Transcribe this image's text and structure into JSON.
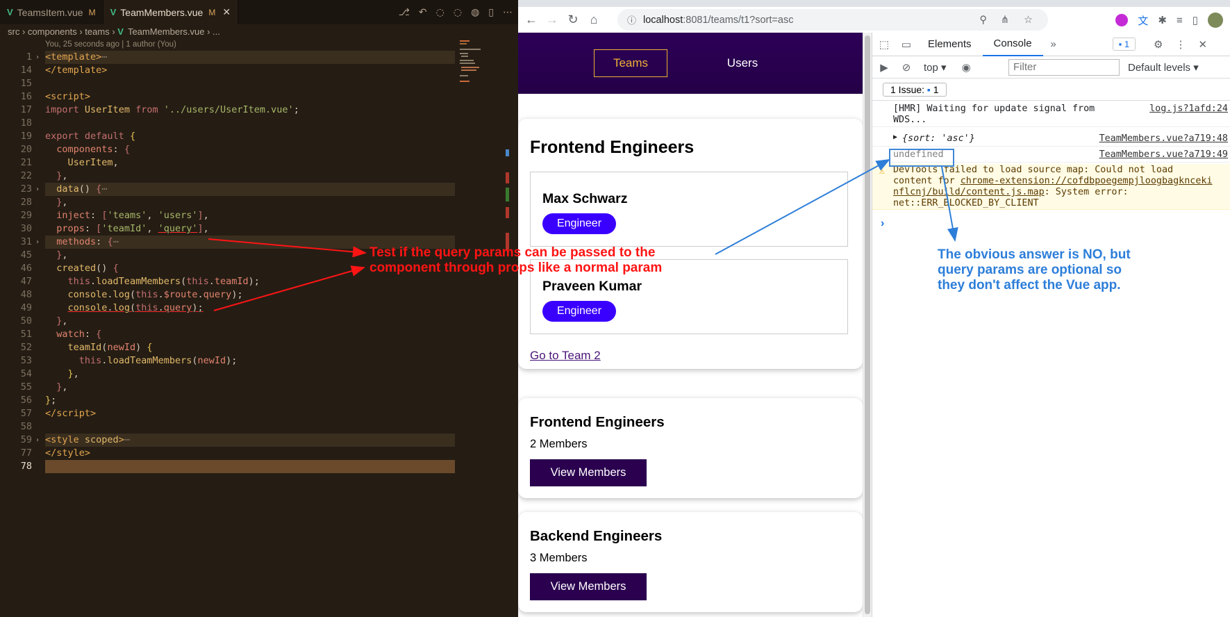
{
  "editor": {
    "tabs": [
      {
        "name": "TeamsItem.vue",
        "mod": "M"
      },
      {
        "name": "TeamMembers.vue",
        "mod": "M"
      }
    ],
    "breadcrumb": [
      "src",
      "components",
      "teams",
      "TeamMembers.vue",
      "..."
    ],
    "blame": "You, 25 seconds ago | 1 author (You)",
    "line_numbers": [
      "1",
      "14",
      "15",
      "16",
      "17",
      "18",
      "19",
      "20",
      "21",
      "22",
      "23",
      "28",
      "29",
      "30",
      "31",
      "45",
      "46",
      "47",
      "48",
      "49",
      "50",
      "51",
      "52",
      "53",
      "54",
      "55",
      "56",
      "57",
      "58",
      "59",
      "77",
      "78"
    ]
  },
  "browser": {
    "url_host": "localhost",
    "url_path": ":8081/teams/t1?sort=asc",
    "nav": {
      "teams": "Teams",
      "users": "Users"
    },
    "team": {
      "title": "Frontend Engineers",
      "members": [
        {
          "name": "Max Schwarz",
          "role": "Engineer"
        },
        {
          "name": "Praveen Kumar",
          "role": "Engineer"
        }
      ],
      "link": "Go to Team 2"
    },
    "teams_list": [
      {
        "name": "Frontend Engineers",
        "count": "2 Members",
        "button": "View Members"
      },
      {
        "name": "Backend Engineers",
        "count": "3 Members",
        "button": "View Members"
      }
    ]
  },
  "devtools": {
    "tabs": {
      "elements": "Elements",
      "console": "Console",
      "badge": "1"
    },
    "toolbar": {
      "context": "top",
      "filter_placeholder": "Filter",
      "levels": "Default levels"
    },
    "issues": {
      "label": "1 Issue:",
      "count": "1"
    },
    "console": [
      {
        "msg1": "[HMR] Waiting for update signal from",
        "msg2": "WDS...",
        "src": "log.js?1afd:24"
      },
      {
        "msg": "{sort: 'asc'}",
        "src": "TeamMembers.vue?a719:48"
      },
      {
        "msg": "undefined",
        "src": "TeamMembers.vue?a719:49"
      },
      {
        "w1": "DevTools failed to load source map: Could not load",
        "w2a": "content for ",
        "w2b": "chrome-extension://cofdbpoegempjloogbagknceki",
        "w3a": "nflcnj/build/content.js.map",
        "w3b": ": System error:",
        "w4": "net::ERR_BLOCKED_BY_CLIENT"
      }
    ],
    "prompt": "›"
  },
  "annotations": {
    "red_line1": "Test if the query params can be passed to the",
    "red_line2": "component through props like a normal param",
    "blue_line1": "The obvious answer is NO, but",
    "blue_line2": "query params are optional so",
    "blue_line3": "they don't affect the Vue app."
  },
  "colors": {
    "accent_red": "#ff1414",
    "accent_blue": "#2d7ed9",
    "header_purple": "#2d0057",
    "badge_purple": "#3a00ff"
  }
}
